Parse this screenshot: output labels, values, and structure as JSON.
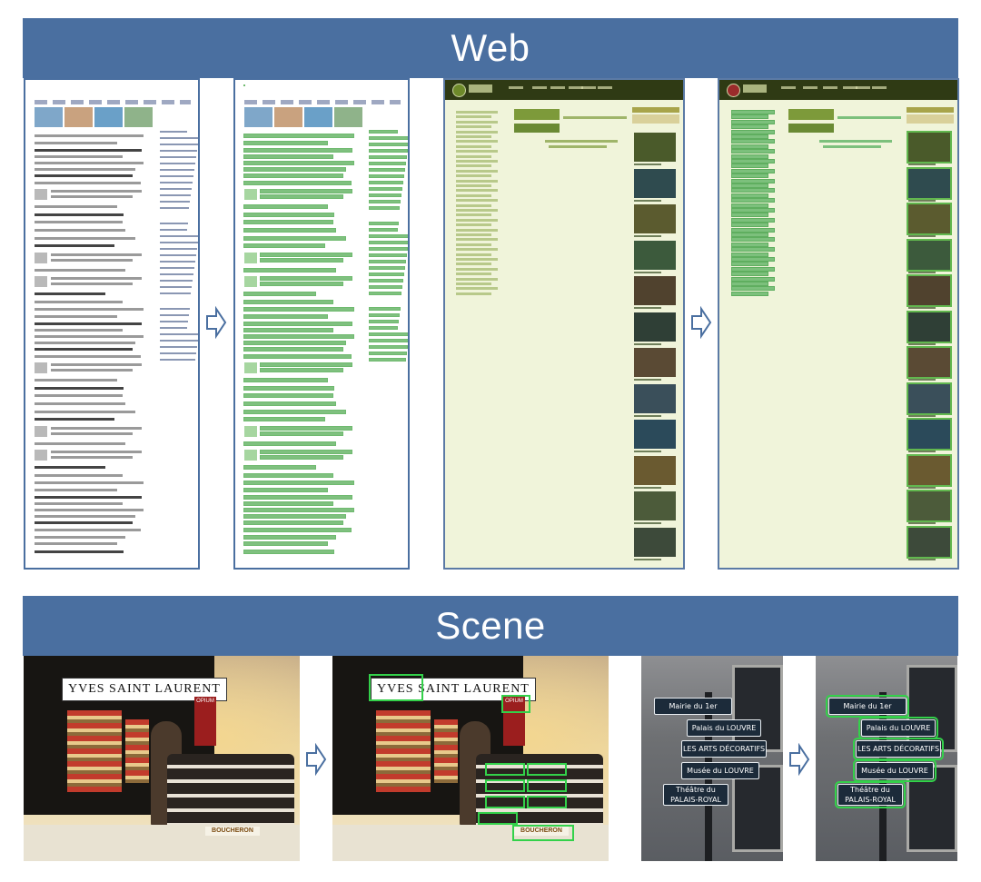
{
  "sections": {
    "web": {
      "label": "Web"
    },
    "scene": {
      "label": "Scene"
    }
  },
  "web": {
    "arrow_icon": "right-outline-arrow-icon"
  },
  "scene": {
    "store_logo": "YVES SAINT LAURENT",
    "store_opium_label": "OPIUM",
    "store_boucheron_label": "BOUCHERON",
    "street_signs": [
      "Mairie du 1er",
      "Palais du LOUVRE",
      "LES ARTS DÉCORATIFS",
      "Musée du LOUVRE",
      "Théâtre du PALAIS-ROYAL"
    ]
  },
  "colors": {
    "band": "#4a6fa0",
    "highlight": "#33d14a",
    "zoo_dark": "#3e4a1c"
  }
}
